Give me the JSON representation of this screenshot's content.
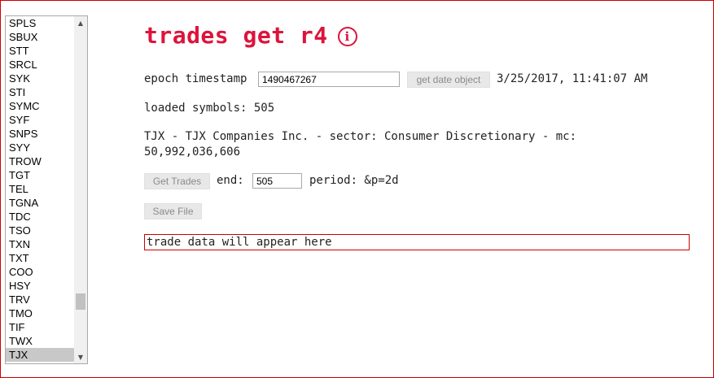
{
  "symbols": {
    "items": [
      "SPLS",
      "SBUX",
      "STT",
      "SRCL",
      "SYK",
      "STI",
      "SYMC",
      "SYF",
      "SNPS",
      "SYY",
      "TROW",
      "TGT",
      "TEL",
      "TGNA",
      "TDC",
      "TSO",
      "TXN",
      "TXT",
      "COO",
      "HSY",
      "TRV",
      "TMO",
      "TIF",
      "TWX",
      "TJX"
    ],
    "selected": "TJX",
    "scroll_up_icon": "triangle-up-icon",
    "scroll_down_icon": "triangle-down-icon"
  },
  "header": {
    "title": "trades get r4",
    "info_icon": "ⓘ"
  },
  "epoch": {
    "label": "epoch timestamp",
    "value": "1490467267",
    "button_label": "get date object",
    "date_text": "3/25/2017, 11:41:07 AM"
  },
  "loaded": {
    "text": "loaded symbols: 505"
  },
  "company": {
    "line1": "TJX - TJX Companies Inc. - sector: Consumer Discretionary - mc:",
    "line2": "50,992,036,606"
  },
  "trades": {
    "button_label": "Get Trades",
    "end_label": "end:",
    "end_value": "505",
    "period_text": "period: &p=2d"
  },
  "save": {
    "button_label": "Save File"
  },
  "output": {
    "text": "trade data will appear here"
  },
  "colors": {
    "accent": "#dc143c",
    "border": "#cc0000"
  }
}
